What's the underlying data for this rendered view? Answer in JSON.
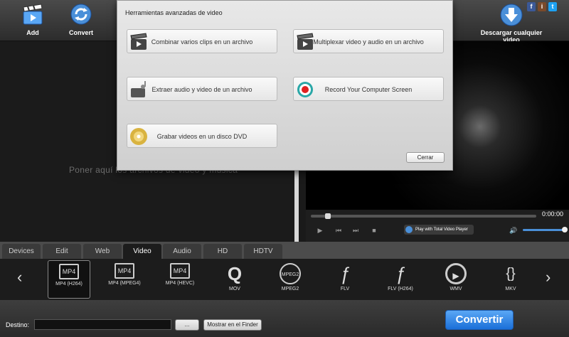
{
  "toolbar": {
    "add_label": "Add",
    "convert_label": "Convert",
    "download_label": "Descargar cualquier video",
    "social": [
      {
        "letter": "f",
        "color": "#3b5998"
      },
      {
        "letter": "i",
        "color": "#7a4a2a"
      },
      {
        "letter": "t",
        "color": "#1da1f2"
      }
    ]
  },
  "dialog": {
    "title": "Herramientas avanzadas de video",
    "merge_label": "Combinar varios clips en un archivo",
    "mux_label": "Multiplexar video y audio en un archivo",
    "extract_label": "Extraer audio y video de un archivo",
    "record_label": "Record Your Computer Screen",
    "dvd_label": "Grabar videos en un disco DVD",
    "close_label": "Cerrar"
  },
  "drop_area": {
    "placeholder": "Poner aquí los archivos de video y música"
  },
  "player": {
    "time": "0:00:00",
    "seek_progress": 0.03,
    "volume": 0.95,
    "tvp_label": "Play with Total Video Player"
  },
  "tabs": [
    {
      "label": "Devices"
    },
    {
      "label": "Edit"
    },
    {
      "label": "Web"
    },
    {
      "label": "Video"
    },
    {
      "label": "Audio"
    },
    {
      "label": "HD"
    },
    {
      "label": "HDTV"
    }
  ],
  "active_tab": "Video",
  "formats": [
    {
      "label": "MP4 (H264)"
    },
    {
      "label": "MP4 (MPEG4)"
    },
    {
      "label": "MP4 (HEVC)"
    },
    {
      "label": "MOV"
    },
    {
      "label": "MPEG2"
    },
    {
      "label": "FLV"
    },
    {
      "label": "FLV (H264)"
    },
    {
      "label": "WMV"
    },
    {
      "label": "MKV"
    }
  ],
  "selected_format": "MP4 (H264)",
  "icon_text": {
    "mp4": "MP4",
    "mpeg2": "MPEG2"
  },
  "bottom": {
    "dest_label": "Destino:",
    "dest_value": "",
    "browse_label": "...",
    "finder_label": "Mostrar en el Finder",
    "convert_label": "Convertir"
  }
}
